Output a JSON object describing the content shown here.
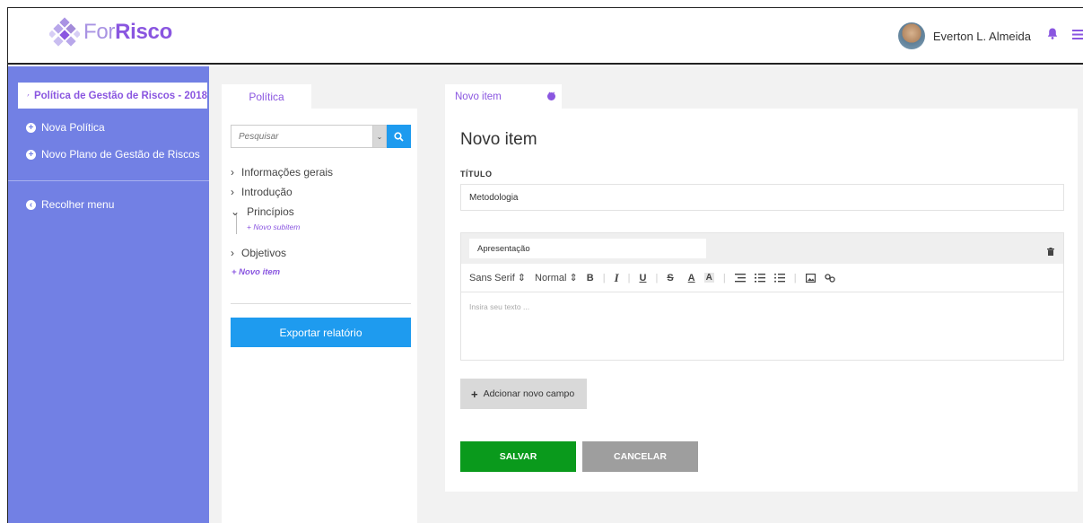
{
  "app": {
    "logo_for": "For",
    "logo_risco": "Risco",
    "accent": "#8a56e0",
    "sidebar_color": "#7280e4",
    "primary_blue": "#1e9bef"
  },
  "header": {
    "user_name": "Everton L. Almeida",
    "icons": [
      "avatar",
      "bell-icon",
      "hamburger-menu-icon"
    ]
  },
  "sidebar": {
    "active_item": "Política de Gestão de Riscos - 2018",
    "items": [
      {
        "label": "Nova Política",
        "icon": "plus-circle-icon"
      },
      {
        "label": "Novo Plano de Gestão de Riscos",
        "icon": "plus-circle-icon"
      }
    ],
    "collapse_label": "Recolher menu"
  },
  "policy_panel": {
    "tab_label": "Política",
    "search": {
      "placeholder": "Pesquisar"
    },
    "tree": [
      {
        "label": "Informações gerais",
        "marker": "›"
      },
      {
        "label": "Introdução",
        "marker": "›"
      },
      {
        "label": "Princípios",
        "marker": "⌄"
      },
      {
        "label": "Objetivos",
        "marker": "›"
      }
    ],
    "new_subitem": "+  Novo subitem",
    "new_item": "+  Novo item",
    "export_label": "Exportar relatório"
  },
  "editor_panel": {
    "tab_label": "Novo item",
    "heading": "Novo item",
    "title_label": "TÍTULO",
    "title_value": "Metodologia",
    "section_name": "Apresentação",
    "toolbar": {
      "font": "Sans Serif",
      "size": "Normal",
      "bold": "B",
      "italic": "I",
      "underline": "U",
      "strike": "S",
      "color": "A",
      "background": "A"
    },
    "body_placeholder": "Insira seu texto ...",
    "add_field_label": "Adcionar novo campo",
    "save_label": "SALVAR",
    "cancel_label": "CANCELAR"
  }
}
